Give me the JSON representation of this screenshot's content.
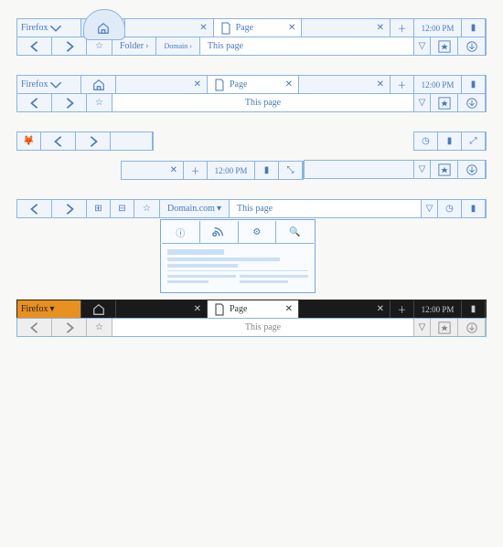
{
  "app": "Firefox",
  "tab_label": "Page",
  "addr_placeholder": "This page",
  "breadcrumb": {
    "folder": "Folder",
    "domain": "Domain"
  },
  "domain_label": "Domain.com",
  "time": "12:00 PM",
  "mockups": [
    "sketch-home-bump",
    "sketch-plain",
    "sketch-compact",
    "sketch-domain-popup",
    "dark-theme"
  ]
}
